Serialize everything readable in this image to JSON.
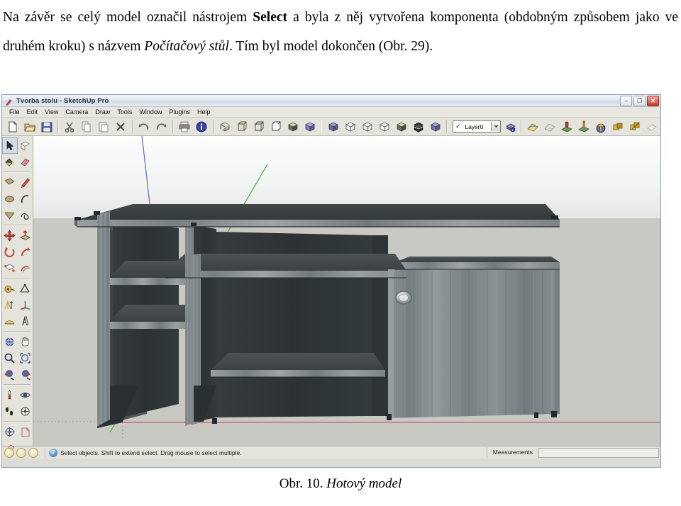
{
  "document": {
    "paragraph1_part1": "Na závěr se celý model označil nástrojem ",
    "paragraph1_bold": "Select",
    "paragraph1_part2": " a byla z něj vytvořena komponenta (obdobným způsobem jako ve druhém kroku) s názvem ",
    "paragraph1_italic": "Počítačový stůl",
    "paragraph1_part3": ". Tím byl model dokončen (Obr. 29).",
    "caption_prefix": "Obr. 10. ",
    "caption_italic": "Hotový model"
  },
  "window": {
    "title": "Tvorba stolu - SketchUp Pro",
    "minimize_label": "–",
    "maximize_label": "❐",
    "close_label": "✕"
  },
  "menubar": {
    "items": [
      {
        "label": "File"
      },
      {
        "label": "Edit"
      },
      {
        "label": "View"
      },
      {
        "label": "Camera"
      },
      {
        "label": "Draw"
      },
      {
        "label": "Tools"
      },
      {
        "label": "Window"
      },
      {
        "label": "Plugins"
      },
      {
        "label": "Help"
      }
    ]
  },
  "toolbar": {
    "standard": [
      {
        "icon": "new-document-icon"
      },
      {
        "icon": "open-folder-icon"
      },
      {
        "icon": "save-icon"
      }
    ],
    "edit": [
      {
        "icon": "cut-scissors-icon"
      },
      {
        "icon": "copy-icon"
      },
      {
        "icon": "paste-icon"
      },
      {
        "icon": "delete-x-icon"
      }
    ],
    "history": [
      {
        "icon": "undo-icon"
      },
      {
        "icon": "redo-icon"
      }
    ],
    "output": [
      {
        "icon": "print-icon"
      },
      {
        "icon": "model-info-icon"
      }
    ],
    "styles": [
      {
        "icon": "style-xray-icon"
      },
      {
        "icon": "style-back-edges-icon"
      },
      {
        "icon": "style-wireframe-icon"
      },
      {
        "icon": "style-hidden-line-icon"
      },
      {
        "icon": "style-shaded-icon"
      },
      {
        "icon": "style-shaded-texture-icon"
      }
    ],
    "views": [
      {
        "icon": "view-iso-icon"
      },
      {
        "icon": "view-top-icon"
      },
      {
        "icon": "view-front-icon"
      },
      {
        "icon": "view-right-icon"
      },
      {
        "icon": "view-perspective-icon"
      },
      {
        "icon": "view-section-icon"
      },
      {
        "icon": "view-shaded-cube-icon"
      }
    ],
    "layers": {
      "check_mark": "✓",
      "current_layer": "Layer0",
      "dropdown_arrow": "▼",
      "layer_manager_icon": "layer-manager-icon"
    },
    "sandbox": [
      {
        "icon": "sandbox-from-contours-icon"
      },
      {
        "icon": "sandbox-from-scratch-icon"
      },
      {
        "icon": "sandbox-smoove-icon"
      },
      {
        "icon": "sandbox-stamp-icon"
      },
      {
        "icon": "sandbox-drape-icon"
      },
      {
        "icon": "sandbox-add-detail-icon"
      },
      {
        "icon": "sandbox-flip-edge-icon"
      },
      {
        "icon": "sandbox-extra-icon"
      }
    ]
  },
  "tool_palette": {
    "groups": [
      [
        {
          "icon": "select-arrow-icon",
          "active": true
        },
        {
          "icon": "make-component-icon",
          "active": false
        },
        {
          "icon": "paint-bucket-icon",
          "active": false
        },
        {
          "icon": "eraser-icon",
          "active": false
        }
      ],
      [
        {
          "icon": "rectangle-icon",
          "active": false
        },
        {
          "icon": "line-pencil-icon",
          "active": false
        },
        {
          "icon": "circle-icon",
          "active": false
        },
        {
          "icon": "arc-icon",
          "active": false
        },
        {
          "icon": "polygon-icon",
          "active": false
        },
        {
          "icon": "freehand-icon",
          "active": false
        }
      ],
      [
        {
          "icon": "move-icon",
          "active": false
        },
        {
          "icon": "push-pull-icon",
          "active": false
        },
        {
          "icon": "rotate-icon",
          "active": false
        },
        {
          "icon": "follow-me-icon",
          "active": false
        },
        {
          "icon": "scale-icon",
          "active": false
        },
        {
          "icon": "offset-icon",
          "active": false
        }
      ],
      [
        {
          "icon": "tape-measure-icon",
          "active": false
        },
        {
          "icon": "dimension-icon",
          "active": false
        },
        {
          "icon": "protractor-icon",
          "active": false
        },
        {
          "icon": "text-label-icon",
          "active": false
        },
        {
          "icon": "axes-icon",
          "active": false
        },
        {
          "icon": "three-d-text-icon",
          "active": false
        }
      ],
      [
        {
          "icon": "orbit-icon",
          "active": false
        },
        {
          "icon": "pan-hand-icon",
          "active": false
        },
        {
          "icon": "zoom-magnifier-icon",
          "active": false
        },
        {
          "icon": "zoom-window-icon",
          "active": false
        },
        {
          "icon": "previous-view-icon",
          "active": false
        },
        {
          "icon": "next-view-icon",
          "active": false
        }
      ],
      [
        {
          "icon": "position-camera-icon",
          "active": false
        },
        {
          "icon": "look-around-eye-icon",
          "active": false
        },
        {
          "icon": "walk-footsteps-icon",
          "active": false
        },
        {
          "icon": "field-of-view-icon",
          "active": false
        }
      ],
      [
        {
          "icon": "section-plane-icon",
          "active": false
        },
        {
          "icon": "page-add-icon",
          "active": false
        },
        {
          "icon": "page-delete-icon",
          "active": false
        }
      ]
    ]
  },
  "viewport": {
    "model_name": "Počítačový stůl",
    "axis_red_label": "red-x-axis",
    "axis_green_label": "green-y-axis",
    "axis_blue_label": "blue-z-axis",
    "colors": {
      "sky_top": "#fdfdfd",
      "ground": "#c9c9c4",
      "axis_red": "#c0707a",
      "axis_green": "#4aa84a",
      "axis_blue": "#6a74b4",
      "wood_dark": "#3b4042",
      "wood_mid": "#6d7577",
      "wood_light": "#8d9496"
    }
  },
  "statusbar": {
    "hint": "Select objects. Shift to extend select. Drag mouse to select multiple.",
    "help_symbol": "?",
    "measurements_label": "Measurements",
    "measurements_value": ""
  }
}
